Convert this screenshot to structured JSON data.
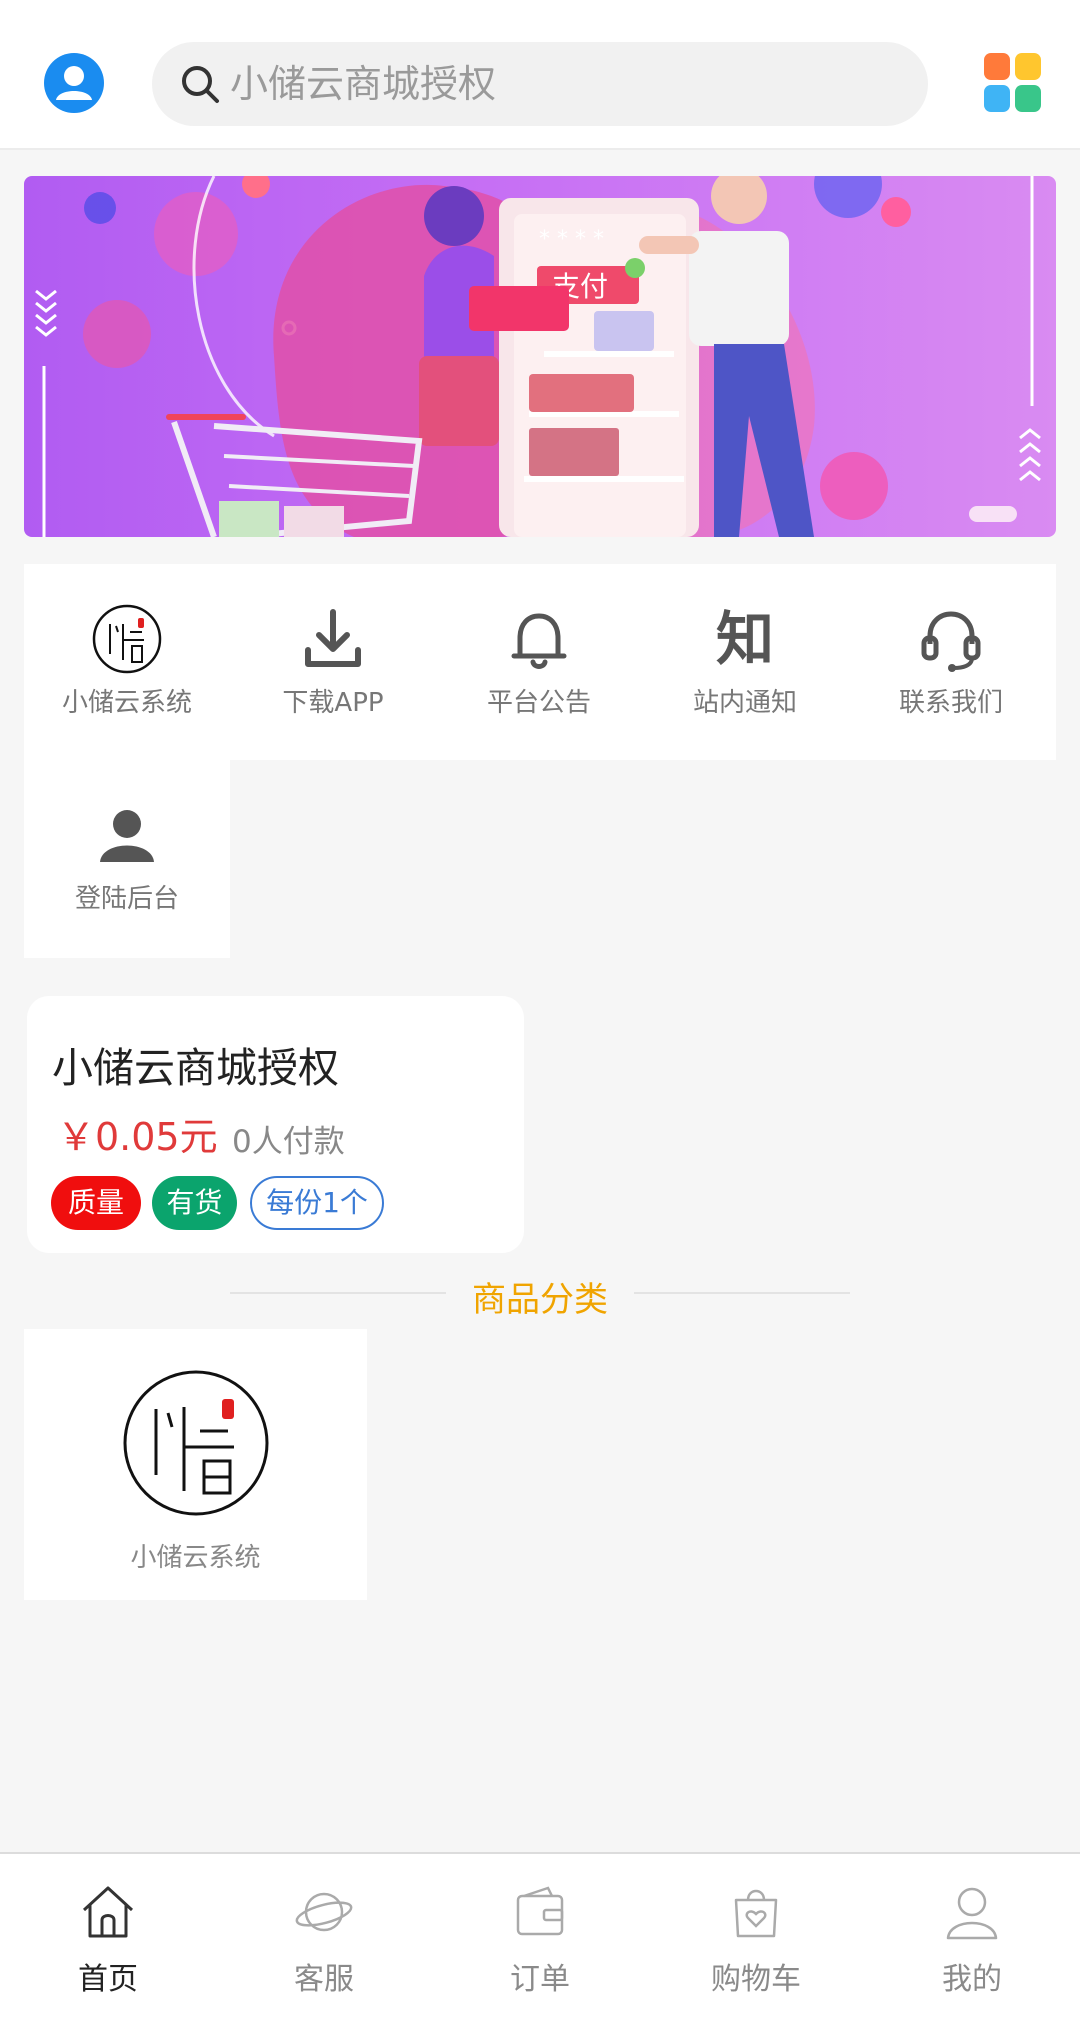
{
  "header": {
    "search_placeholder": "小储云商城授权"
  },
  "banner": {
    "pay_label": "支付"
  },
  "menu": {
    "items": [
      {
        "label": "小储云系统",
        "icon": "logo-icon"
      },
      {
        "label": "下载APP",
        "icon": "download-icon"
      },
      {
        "label": "平台公告",
        "icon": "bell-icon"
      },
      {
        "label": "站内通知",
        "icon": "zhi-icon"
      },
      {
        "label": "联系我们",
        "icon": "headset-icon"
      },
      {
        "label": "登陆后台",
        "icon": "user-icon"
      }
    ],
    "zhi_glyph": "知"
  },
  "product": {
    "title": "小储云商城授权",
    "price": "￥0.05元",
    "sold": "0人付款",
    "tags": {
      "quality": "质量",
      "stock": "有货",
      "unit": "每份1个"
    }
  },
  "section": {
    "title": "商品分类"
  },
  "category": {
    "label": "小储云系统"
  },
  "tabbar": {
    "items": [
      {
        "label": "首页",
        "icon": "home-icon",
        "active": true
      },
      {
        "label": "客服",
        "icon": "planet-icon",
        "active": false
      },
      {
        "label": "订单",
        "icon": "wallet-icon",
        "active": false
      },
      {
        "label": "购物车",
        "icon": "shopping-bag-icon",
        "active": false
      },
      {
        "label": "我的",
        "icon": "profile-icon",
        "active": false
      }
    ]
  },
  "colors": {
    "accent_blue": "#1a8cf0",
    "price_red": "#e03a3a",
    "section_orange": "#f0a400",
    "tag_red": "#f00e0e",
    "tag_green": "#0ba46d",
    "tag_blue": "#3a7bd5"
  }
}
